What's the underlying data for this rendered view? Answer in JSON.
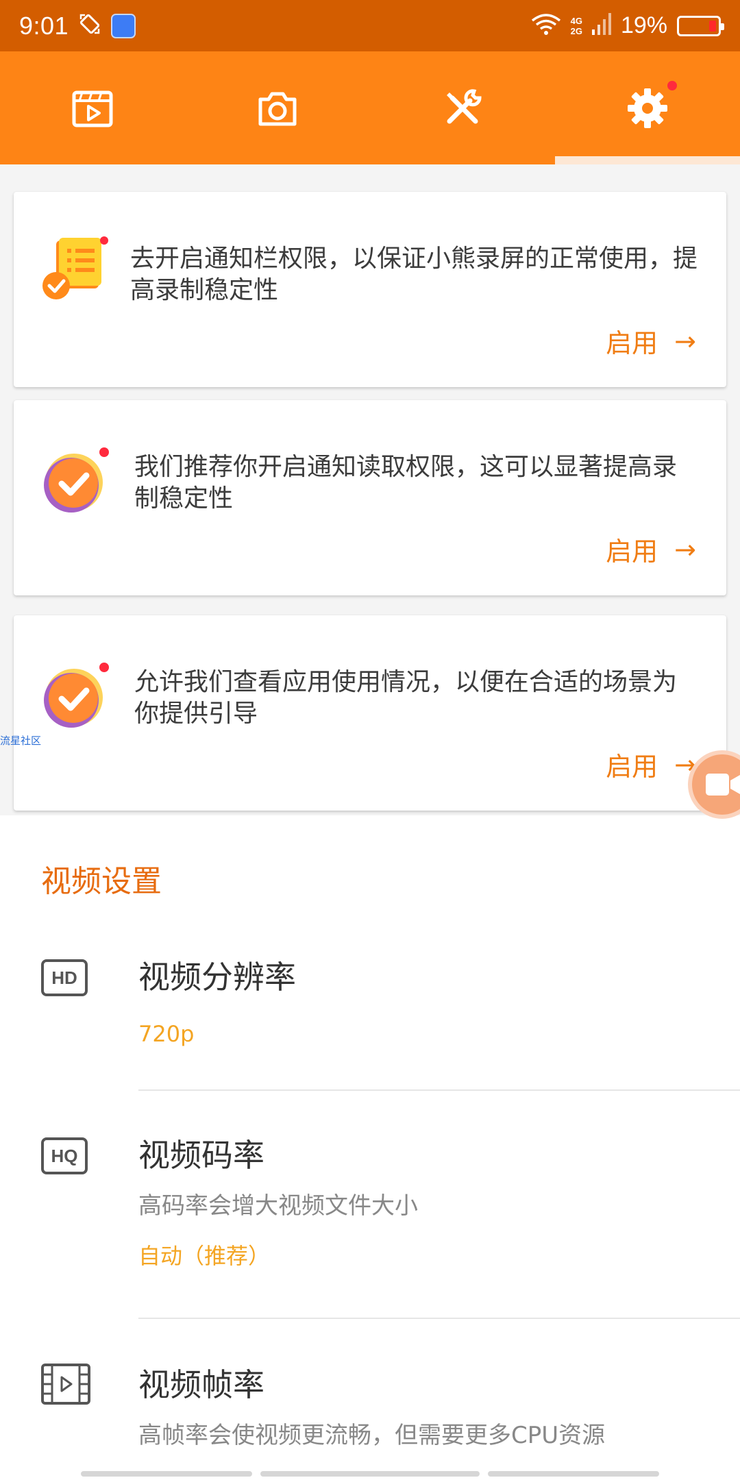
{
  "status": {
    "time": "9:01",
    "network_top": "4G",
    "network_bottom": "2G",
    "battery_pct": "19%",
    "battery_level": 0.19
  },
  "tabs": [
    {
      "name": "video-list",
      "icon": "clapperboard-icon"
    },
    {
      "name": "screenshot",
      "icon": "camera-icon"
    },
    {
      "name": "tools",
      "icon": "tools-icon"
    },
    {
      "name": "settings",
      "icon": "gear-icon",
      "active": true,
      "has_dot": true
    }
  ],
  "cards": [
    {
      "text": "去开启通知栏权限，以保证小熊录屏的正常使用，提高录制稳定性",
      "action": "启用",
      "icon": "notification-list-icon"
    },
    {
      "text": "我们推荐你开启通知读取权限，这可以显著提高录制稳定性",
      "action": "启用",
      "icon": "check-circle-icon"
    },
    {
      "text": "允许我们查看应用使用情况，以便在合适的场景为你提供引导",
      "action": "启用",
      "icon": "check-circle-icon"
    }
  ],
  "watermark": "流星社区",
  "settings": {
    "section_title": "视频设置",
    "resolution": {
      "badge": "HD",
      "title": "视频分辨率",
      "value": "720p"
    },
    "bitrate": {
      "badge": "HQ",
      "title": "视频码率",
      "subtitle": "高码率会增大视频文件大小",
      "value": "自动（推荐）"
    },
    "framerate": {
      "title": "视频帧率",
      "subtitle": "高帧率会使视频更流畅，但需要更多CPU资源"
    }
  },
  "colors": {
    "status_bar": "#d35d00",
    "tab_bar": "#fe8415",
    "accent": "#f07d14",
    "value": "#f4a523"
  }
}
